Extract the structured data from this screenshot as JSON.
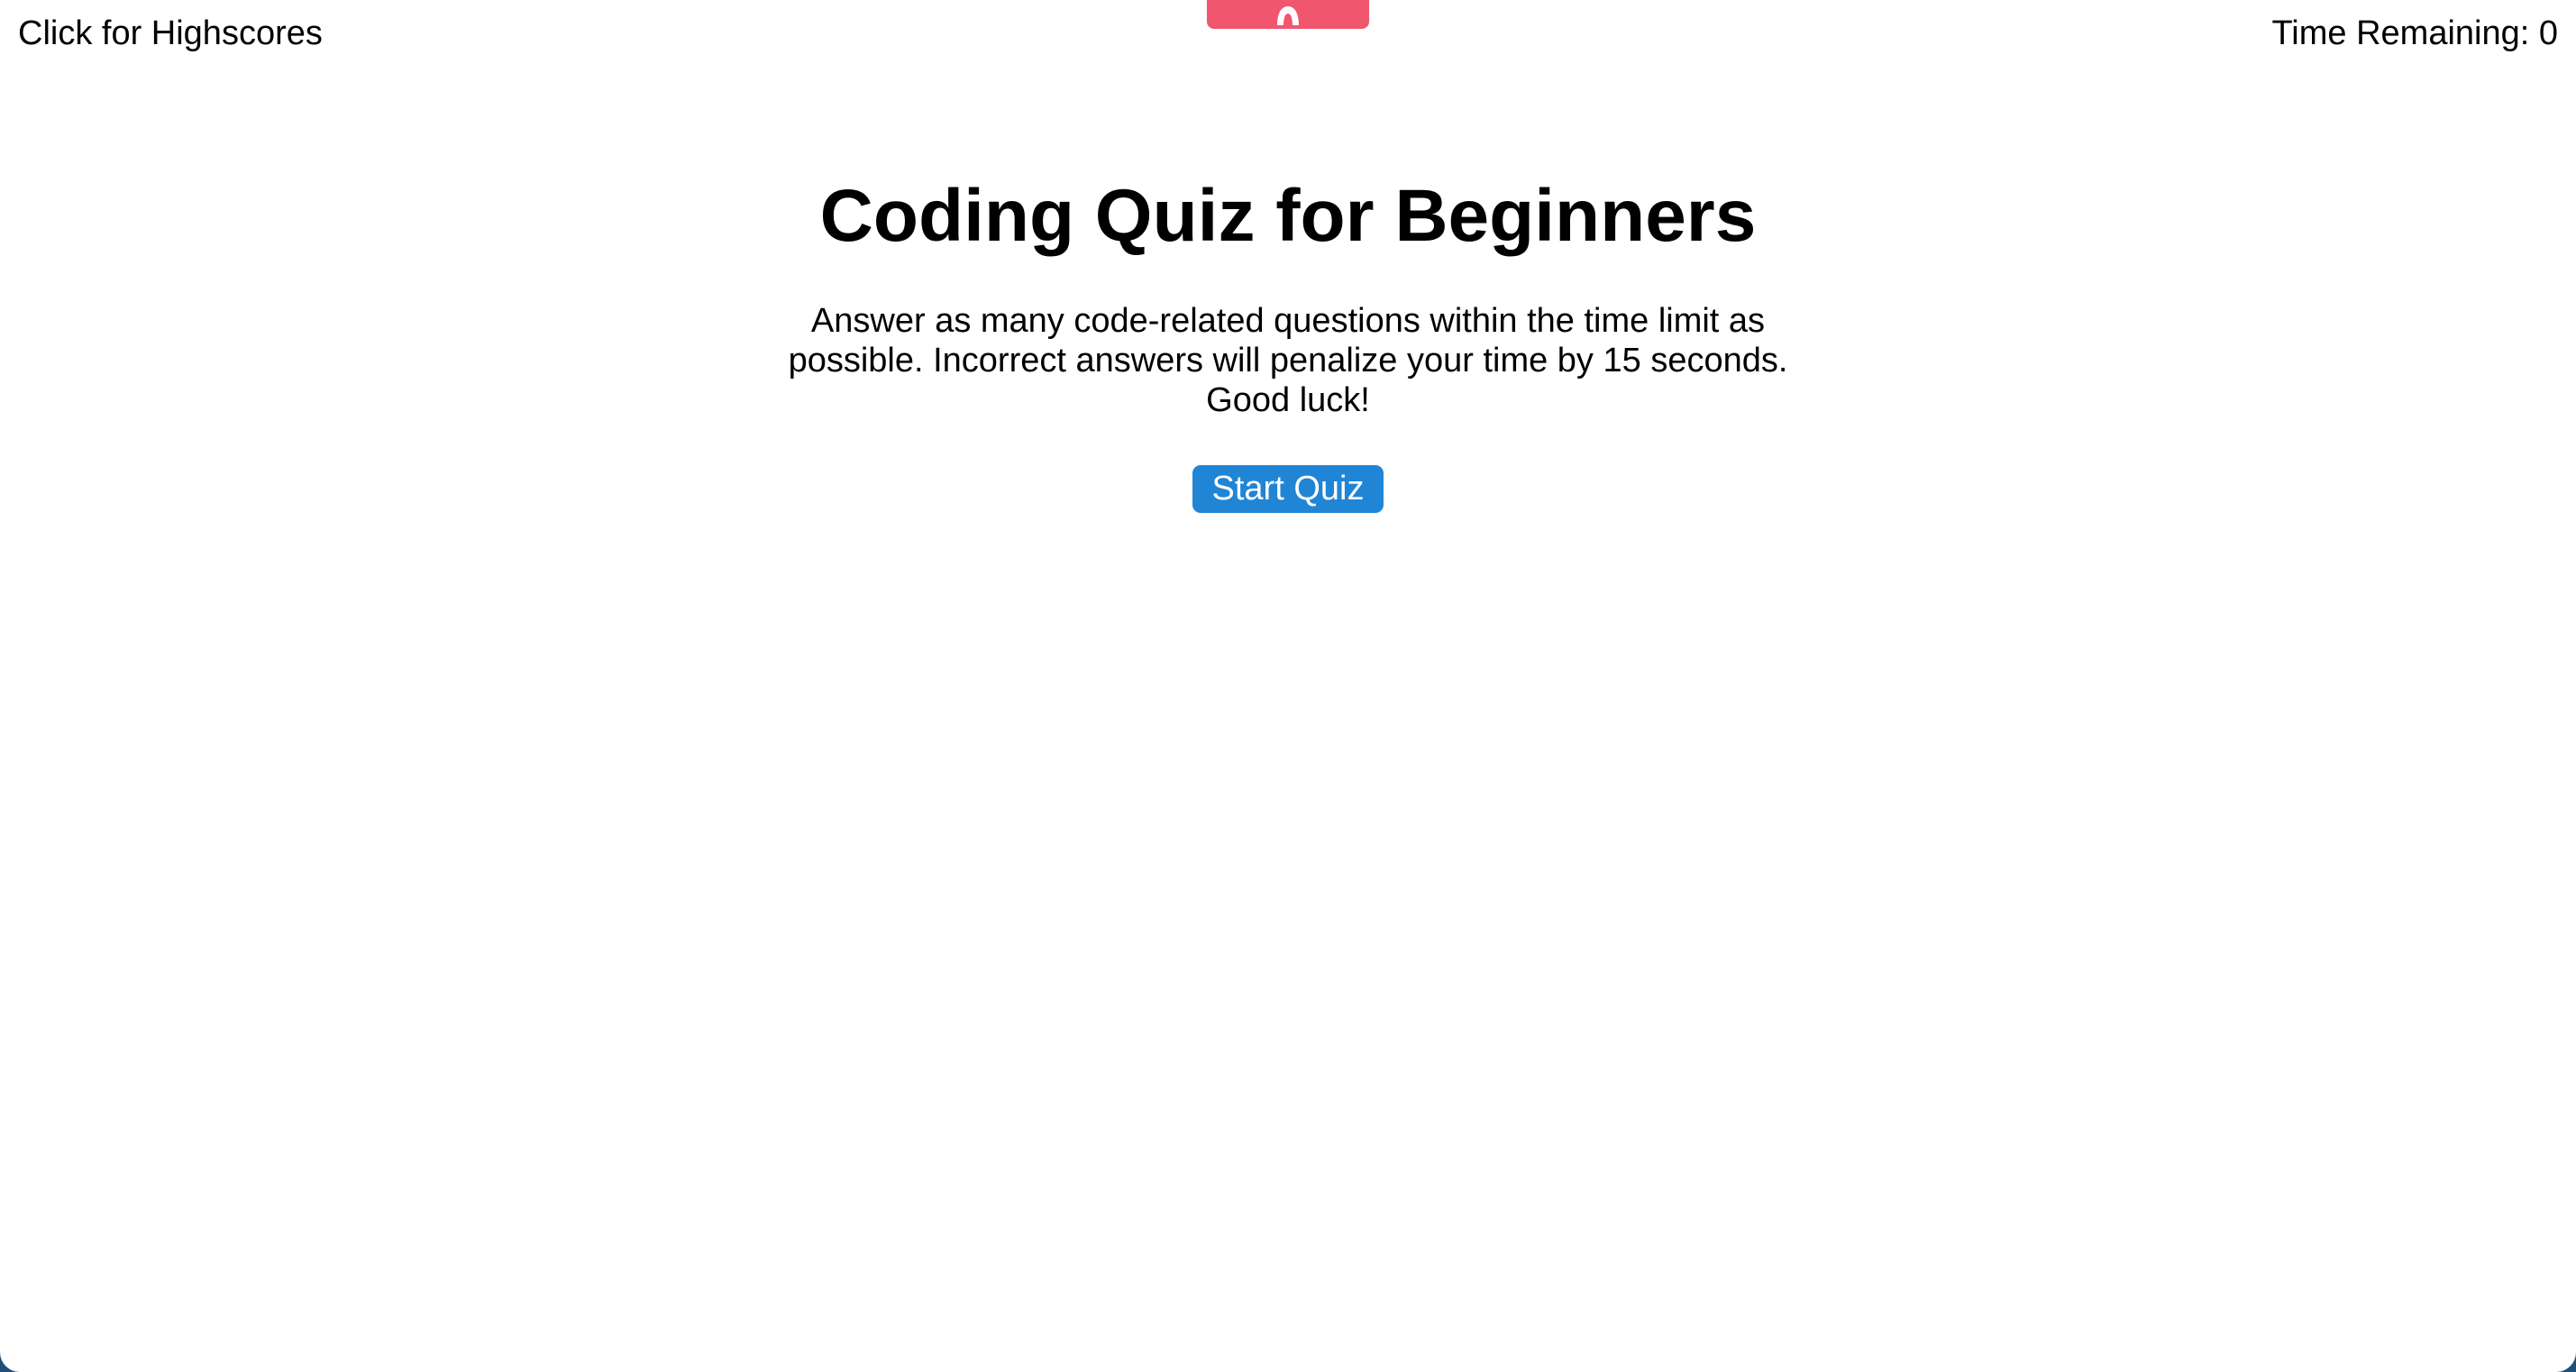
{
  "header": {
    "highscores_link": "Click for Highscores",
    "timer_label": "Time Remaining: 0"
  },
  "extension_tab": {
    "icon": "arch-icon",
    "color": "#f0566e"
  },
  "main": {
    "title": "Coding Quiz for Beginners",
    "description": "Answer as many code-related questions within the time limit as possible. Incorrect answers will penalize your time by 15 seconds. Good luck!",
    "start_button_label": "Start Quiz",
    "start_button_color": "#2185d5"
  }
}
